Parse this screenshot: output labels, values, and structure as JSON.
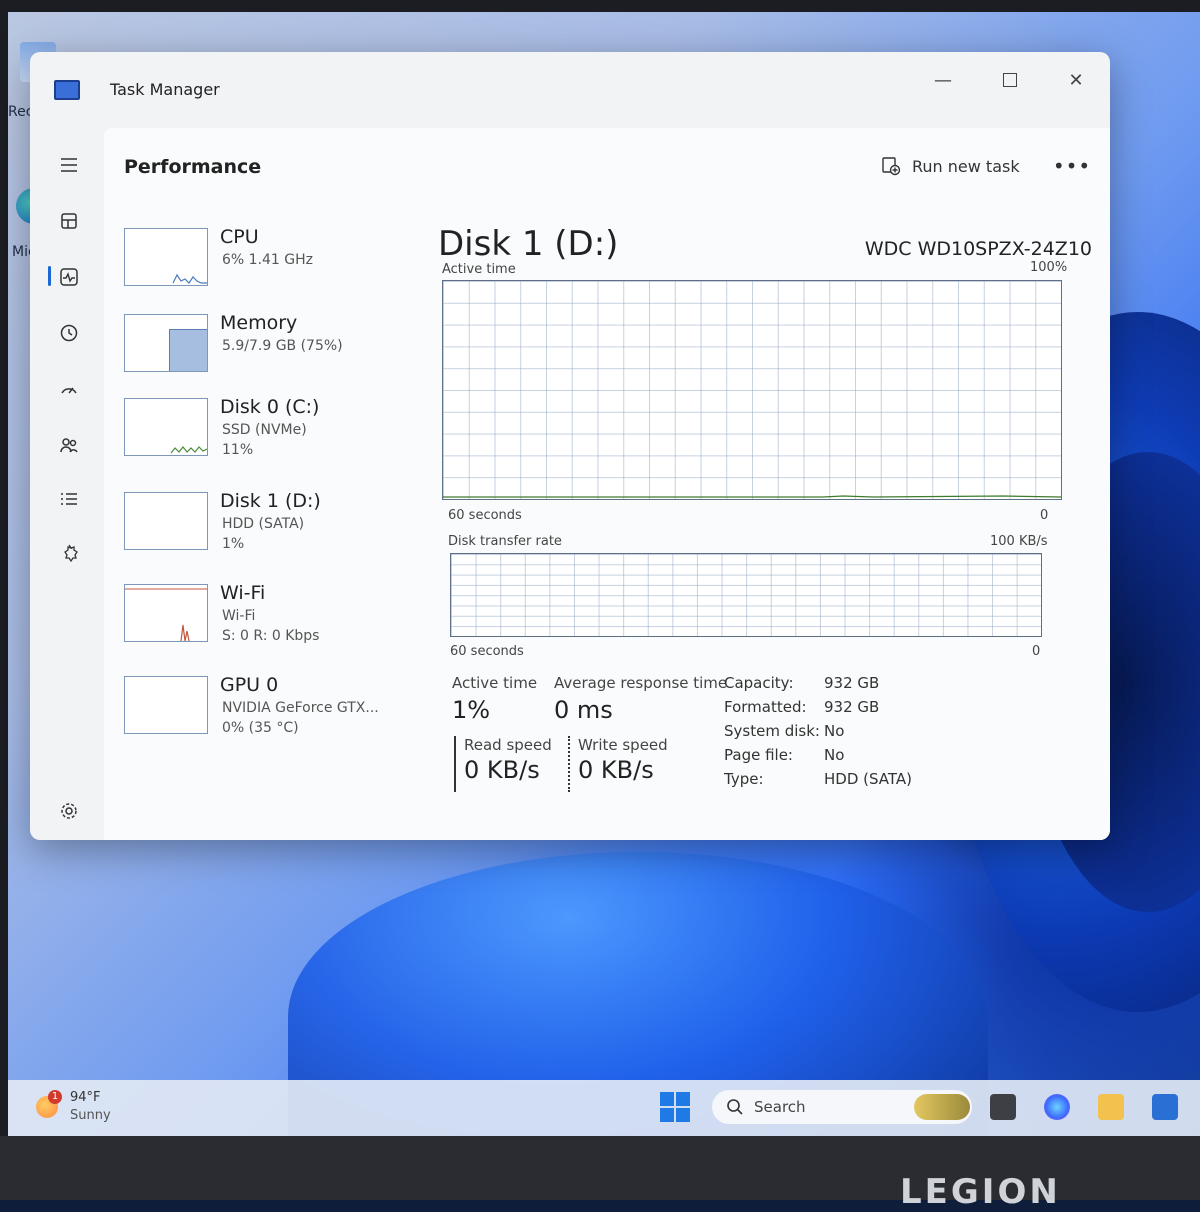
{
  "window": {
    "title": "Task Manager",
    "minimize_glyph": "—",
    "close_glyph": "✕"
  },
  "header": {
    "title": "Performance",
    "run_new_task": "Run new task",
    "more_glyph": "•••"
  },
  "nav_icons": [
    "hamburger-icon",
    "processes-icon",
    "performance-icon",
    "app-history-icon",
    "startup-apps-icon",
    "users-icon",
    "details-icon",
    "services-icon",
    "settings-icon"
  ],
  "devices": [
    {
      "name": "CPU",
      "sub": "6%  1.41 GHz",
      "sub2": ""
    },
    {
      "name": "Memory",
      "sub": "5.9/7.9 GB (75%)",
      "sub2": ""
    },
    {
      "name": "Disk 0 (C:)",
      "sub": "SSD (NVMe)",
      "sub2": "11%"
    },
    {
      "name": "Disk 1 (D:)",
      "sub": "HDD (SATA)",
      "sub2": "1%"
    },
    {
      "name": "Wi-Fi",
      "sub": "Wi-Fi",
      "sub2": "S: 0 R: 0 Kbps"
    },
    {
      "name": "GPU 0",
      "sub": "NVIDIA GeForce GTX...",
      "sub2": "0% (35 °C)"
    }
  ],
  "detail": {
    "title": "Disk 1 (D:)",
    "model": "WDC WD10SPZX-24Z10",
    "graph1": {
      "label": "Active time",
      "max": "100%",
      "xlabel": "60 seconds",
      "min": "0"
    },
    "graph2": {
      "label": "Disk transfer rate",
      "max": "100 KB/s",
      "xlabel": "60 seconds",
      "min": "0"
    },
    "stats": {
      "active_time_label": "Active time",
      "active_time": "1%",
      "avg_response_label": "Average response time",
      "avg_response": "0 ms",
      "read_label": "Read speed",
      "read": "0 KB/s",
      "write_label": "Write speed",
      "write": "0 KB/s"
    },
    "info": [
      {
        "k": "Capacity:",
        "v": "932 GB"
      },
      {
        "k": "Formatted:",
        "v": "932 GB"
      },
      {
        "k": "System disk:",
        "v": "No"
      },
      {
        "k": "Page file:",
        "v": "No"
      },
      {
        "k": "Type:",
        "v": "HDD (SATA)"
      }
    ]
  },
  "taskbar": {
    "weather_temp": "94°F",
    "weather_cond": "Sunny",
    "weather_badge": "1",
    "search_label": "Search"
  },
  "desktop": {
    "icon1_label": "Recy",
    "icon2_label": "Mic",
    "brand": "LEGION"
  },
  "colors": {
    "accent": "#1a66d4",
    "graph_border": "#5f6f86",
    "taskbar": "#e1e8f4"
  }
}
